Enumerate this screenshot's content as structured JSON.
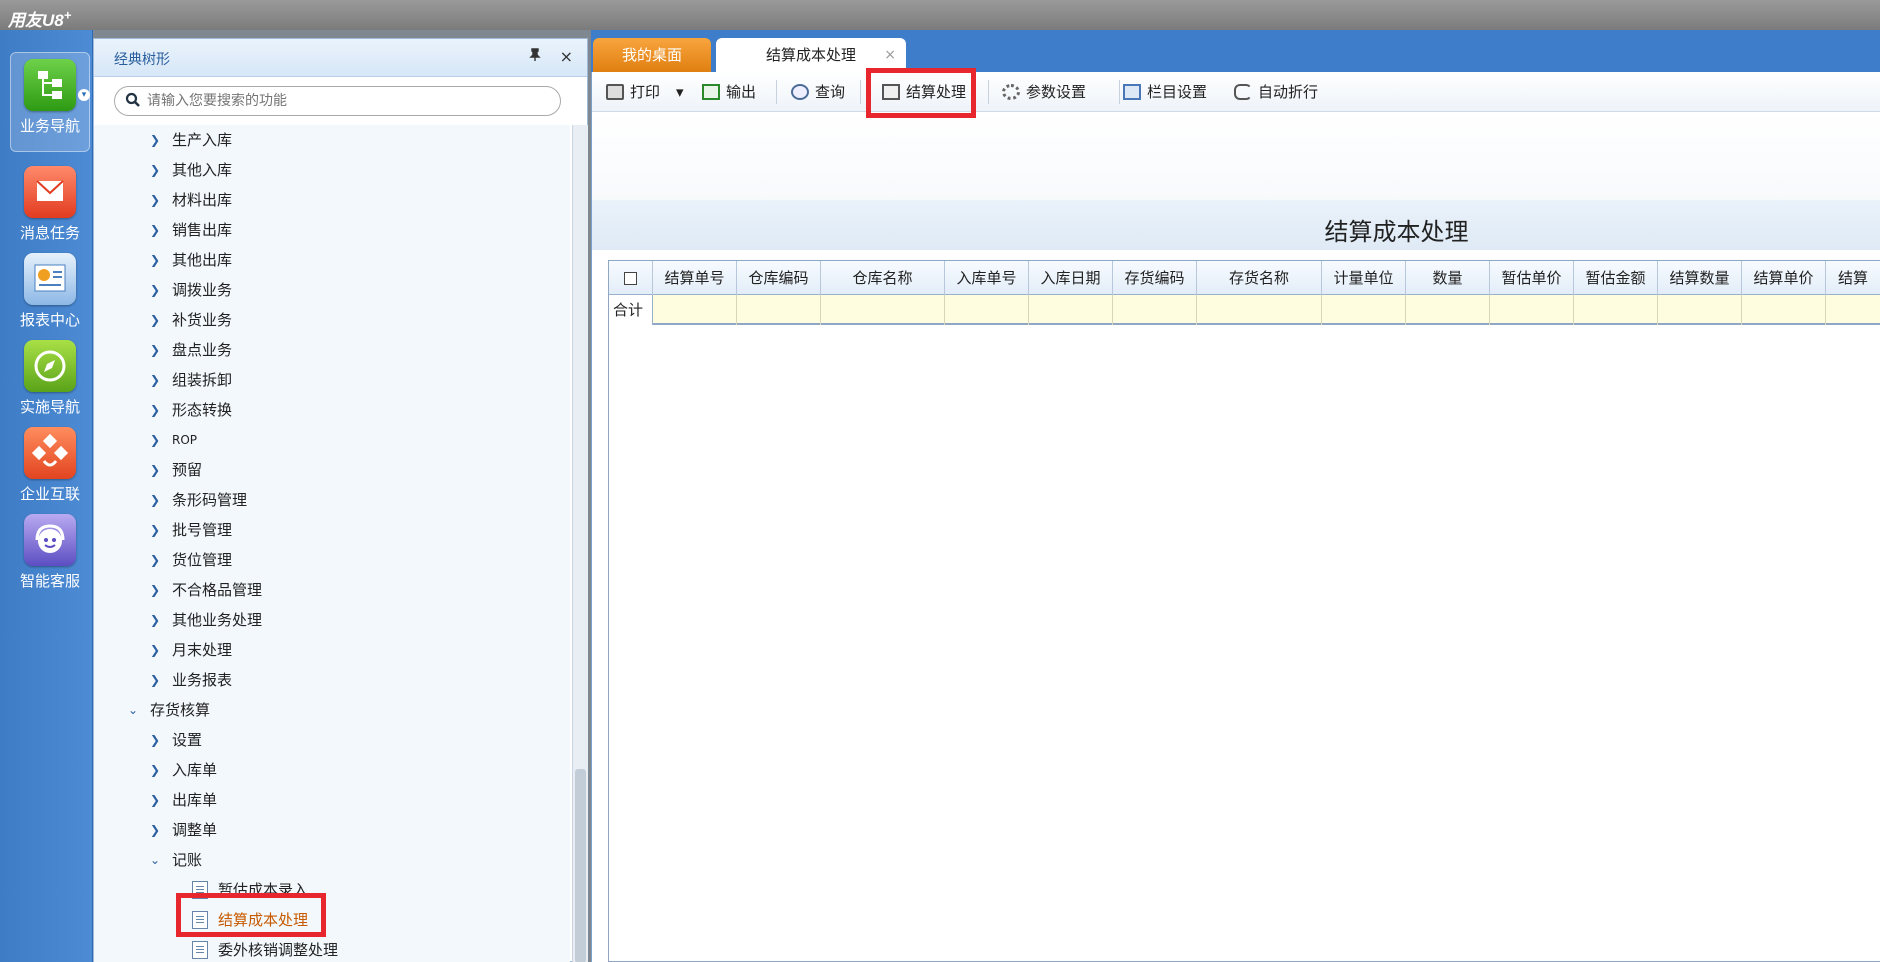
{
  "app": {
    "brand": "用友U8",
    "brand_sup": "+"
  },
  "appbar": {
    "items": [
      {
        "label": "业务导航",
        "icon": "business-nav-icon"
      },
      {
        "label": "消息任务",
        "icon": "message-task-icon"
      },
      {
        "label": "报表中心",
        "icon": "report-center-icon"
      },
      {
        "label": "实施导航",
        "icon": "compass-icon"
      },
      {
        "label": "企业互联",
        "icon": "enterprise-link-icon"
      },
      {
        "label": "智能客服",
        "icon": "support-agent-icon"
      }
    ]
  },
  "tree": {
    "title": "经典树形",
    "pin": "📌",
    "close": "×",
    "search_placeholder": "请输入您要搜索的功能",
    "items": [
      {
        "label": "生产入库"
      },
      {
        "label": "其他入库"
      },
      {
        "label": "材料出库"
      },
      {
        "label": "销售出库"
      },
      {
        "label": "其他出库"
      },
      {
        "label": "调拨业务"
      },
      {
        "label": "补货业务"
      },
      {
        "label": "盘点业务"
      },
      {
        "label": "组装拆卸"
      },
      {
        "label": "形态转换"
      },
      {
        "label": "ROP"
      },
      {
        "label": "预留"
      },
      {
        "label": "条形码管理"
      },
      {
        "label": "批号管理"
      },
      {
        "label": "货位管理"
      },
      {
        "label": "不合格品管理"
      },
      {
        "label": "其他业务处理"
      },
      {
        "label": "月末处理"
      },
      {
        "label": "业务报表"
      },
      {
        "label": "存货核算"
      },
      {
        "label": "设置"
      },
      {
        "label": "入库单"
      },
      {
        "label": "出库单"
      },
      {
        "label": "调整单"
      },
      {
        "label": "记账"
      },
      {
        "label": "暂估成本录入"
      },
      {
        "label": "结算成本处理"
      },
      {
        "label": "委外核销调整处理"
      }
    ]
  },
  "tabs": [
    {
      "label": "我的桌面"
    },
    {
      "label": "结算成本处理",
      "close": "×"
    }
  ],
  "toolbar": {
    "print": "打印",
    "print_dropdown": "▾",
    "export": "输出",
    "query": "查询",
    "settle": "结算处理",
    "params": "参数设置",
    "columns": "栏目设置",
    "autowrap": "自动折行"
  },
  "page": {
    "title": "结算成本处理"
  },
  "grid": {
    "columns": [
      "结算单号",
      "仓库编码",
      "仓库名称",
      "入库单号",
      "入库日期",
      "存货编码",
      "存货名称",
      "计量单位",
      "数量",
      "暂估单价",
      "暂估金额",
      "结算数量",
      "结算单价",
      "结算"
    ],
    "sum_label": "合计"
  }
}
